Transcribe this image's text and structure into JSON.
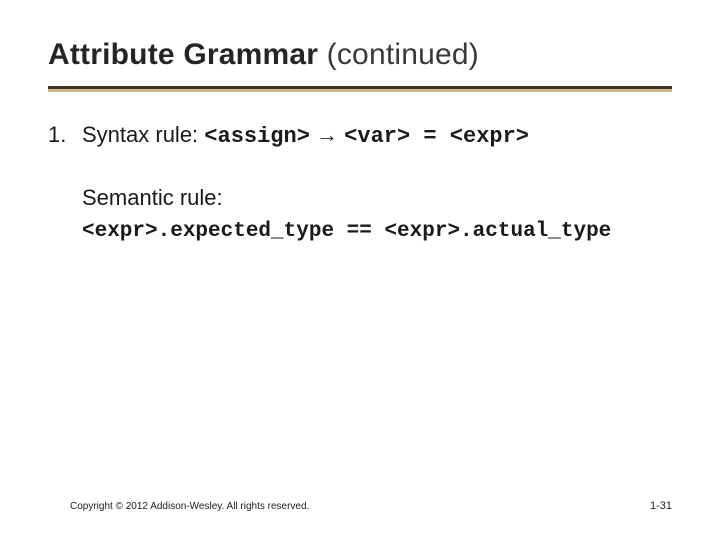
{
  "title": {
    "main": "Attribute Grammar",
    "suffix": "(continued)"
  },
  "item": {
    "number": "1.",
    "label": "Syntax rule:",
    "prod_lhs": "<assign>",
    "arrow": "→",
    "prod_rhs": "<var> = <expr>"
  },
  "semantic": {
    "label": "Semantic rule:",
    "expr": "<expr>.expected_type == <expr>.actual_type"
  },
  "footer": {
    "copyright": "Copyright © 2012 Addison-Wesley. All rights reserved.",
    "page": "1-31"
  }
}
